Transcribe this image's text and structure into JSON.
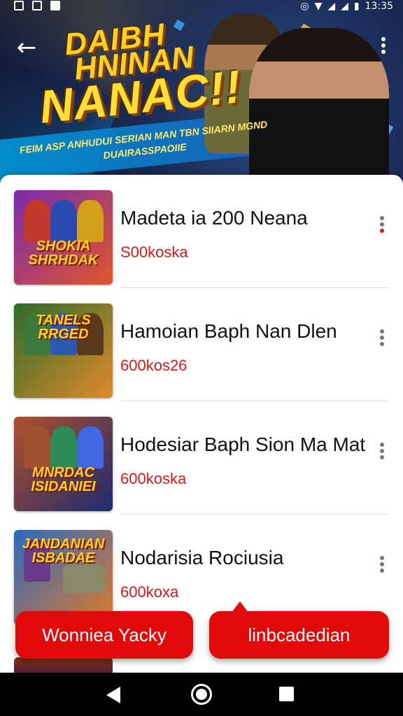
{
  "status_bar": {
    "time": "13:35",
    "left_icons": [
      "notification-icon",
      "gallery-icon",
      "check-icon"
    ],
    "right_icons": [
      "alarm-icon",
      "wifi-icon",
      "signal-icon",
      "signal-icon",
      "battery-icon"
    ]
  },
  "hero": {
    "title_line1": "DAIBH",
    "title_line2": "HNINAN",
    "title_line3": "NANAC!!",
    "subtitle": "FEIM ASP ANHUDUI SERIAN MAN TBN SIIARN MGND DUAIRASSPAOIIE"
  },
  "items": [
    {
      "title": "Madeta ia 200 Neana",
      "subtitle": "S00koska",
      "thumb_text": "SHOKIA SHRHDAK",
      "thumb_colors": [
        "#7a2ab0",
        "#e0562a"
      ]
    },
    {
      "title": "Hamoian Baph Nan Dlen",
      "subtitle": "600kos26",
      "thumb_text": "TANELS RRGED",
      "thumb_colors": [
        "#2d6a2a",
        "#e08a2a"
      ]
    },
    {
      "title": "Hodesiar Baph Sion Ma Mat",
      "subtitle": "600koska",
      "thumb_text": "MNRDAC ISIDANIEI",
      "thumb_colors": [
        "#b0502a",
        "#1e2a70"
      ]
    },
    {
      "title": "Nodarisia Rociusia",
      "subtitle": "600koxa",
      "thumb_text": "JANDANIAN ISBADAE",
      "thumb_colors": [
        "#2a6ac0",
        "#e07a2a"
      ]
    }
  ],
  "actions": {
    "left_label": "Wonniea Yacky",
    "right_label": "linbcadedian"
  },
  "colors": {
    "accent": "#e00a0a",
    "price": "#d31a1a"
  }
}
